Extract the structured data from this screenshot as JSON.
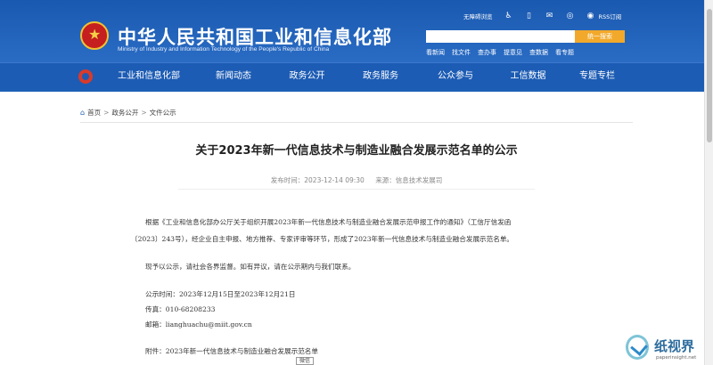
{
  "header": {
    "site_title": "中华人民共和国工业和信息化部",
    "site_subtitle": "Ministry of Industry and Information Technology of the People's Republic of China",
    "topbar": {
      "accessibility": "无障碍浏览",
      "icons": [
        "accessibility-person-icon",
        "mobile-icon",
        "mail-icon",
        "wechat-icon",
        "weibo-icon"
      ],
      "rss": "RSS订阅"
    },
    "search": {
      "placeholder": "",
      "button": "统一搜索"
    },
    "quick_links": [
      "看新闻",
      "找文件",
      "查办事",
      "提意见",
      "查数据",
      "看专题"
    ]
  },
  "nav": {
    "items": [
      "工业和信息化部",
      "新闻动态",
      "政务公开",
      "政务服务",
      "公众参与",
      "工信数据",
      "专题专栏"
    ]
  },
  "breadcrumb": [
    "首页",
    "政务公开",
    "文件公示"
  ],
  "article": {
    "title": "关于2023年新一代信息技术与制造业融合发展示范名单的公示",
    "publish_time": "发布时间：2023-12-14 09:30",
    "source": "来源：信息技术发展司",
    "paragraphs": [
      "根据《工业和信息化部办公厅关于组织开展2023年新一代信息技术与制造业融合发展示范申报工作的通知》（工信厅信发函",
      "〔2023〕243号），经企业自主申报、地方推荐、专家评审等环节，形成了2023年新一代信息技术与制造业融合发展示范名单。",
      "现予以公示，请社会各界监督。如有异议，请在公示期内与我们联系。",
      "公示时间：2023年12月15日至2023年12月21日",
      "传真：010-68208233",
      "邮箱：lianghuachu@miit.gov.cn",
      "附件：2023年新一代信息技术与制造业融合发展示范名单"
    ],
    "float_button": "微信"
  },
  "watermark": {
    "text": "纸视界",
    "url": "paperinsight.net"
  },
  "colors": {
    "brand_blue": "#1d5cb4",
    "search_button": "#f2a92b"
  }
}
